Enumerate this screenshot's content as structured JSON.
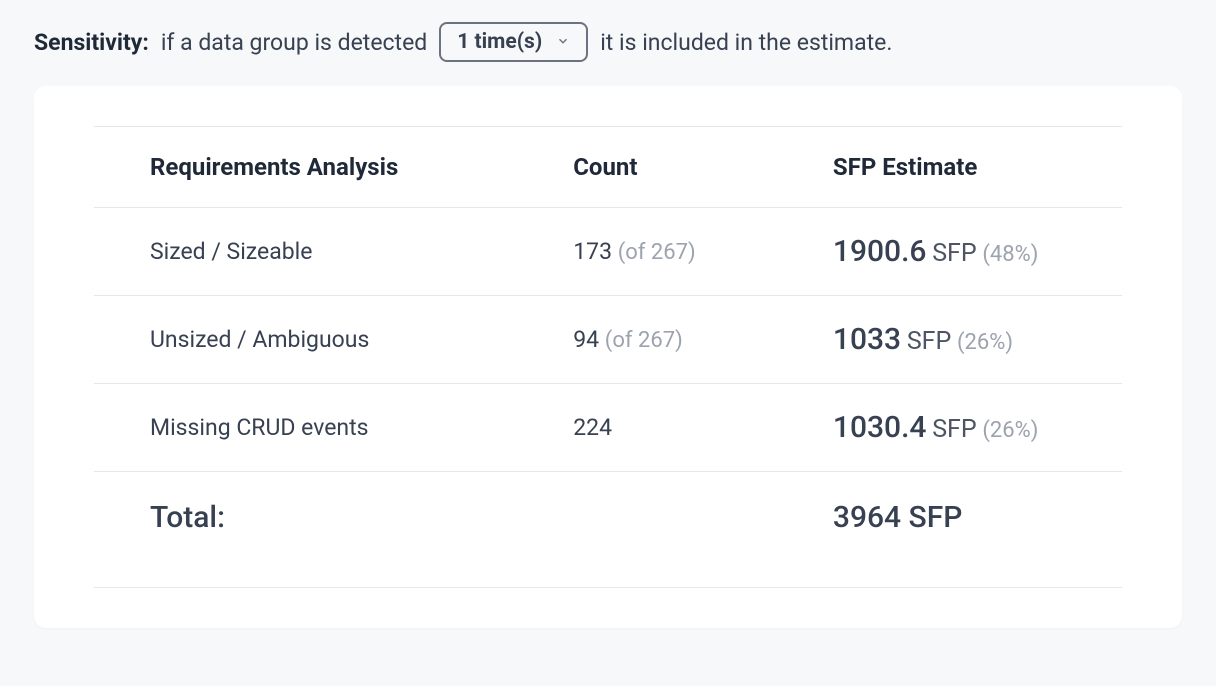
{
  "sensitivity": {
    "label": "Sensitivity:",
    "pre_text": "if a data group is detected",
    "selected": "1 time(s)",
    "post_text": "it is included in the estimate."
  },
  "table": {
    "headers": {
      "col1": "Requirements Analysis",
      "col2": "Count",
      "col3": "SFP Estimate"
    },
    "rows": [
      {
        "label": "Sized / Sizeable",
        "count": "173",
        "count_of": "(of 267)",
        "sfp": "1900.6",
        "sfp_unit": "SFP",
        "pct": "(48%)"
      },
      {
        "label": "Unsized / Ambiguous",
        "count": "94",
        "count_of": "(of 267)",
        "sfp": "1033",
        "sfp_unit": "SFP",
        "pct": "(26%)"
      },
      {
        "label": "Missing CRUD events",
        "count": "224",
        "count_of": "",
        "sfp": "1030.4",
        "sfp_unit": "SFP",
        "pct": "(26%)"
      }
    ],
    "total": {
      "label": "Total:",
      "value": "3964 SFP"
    }
  }
}
